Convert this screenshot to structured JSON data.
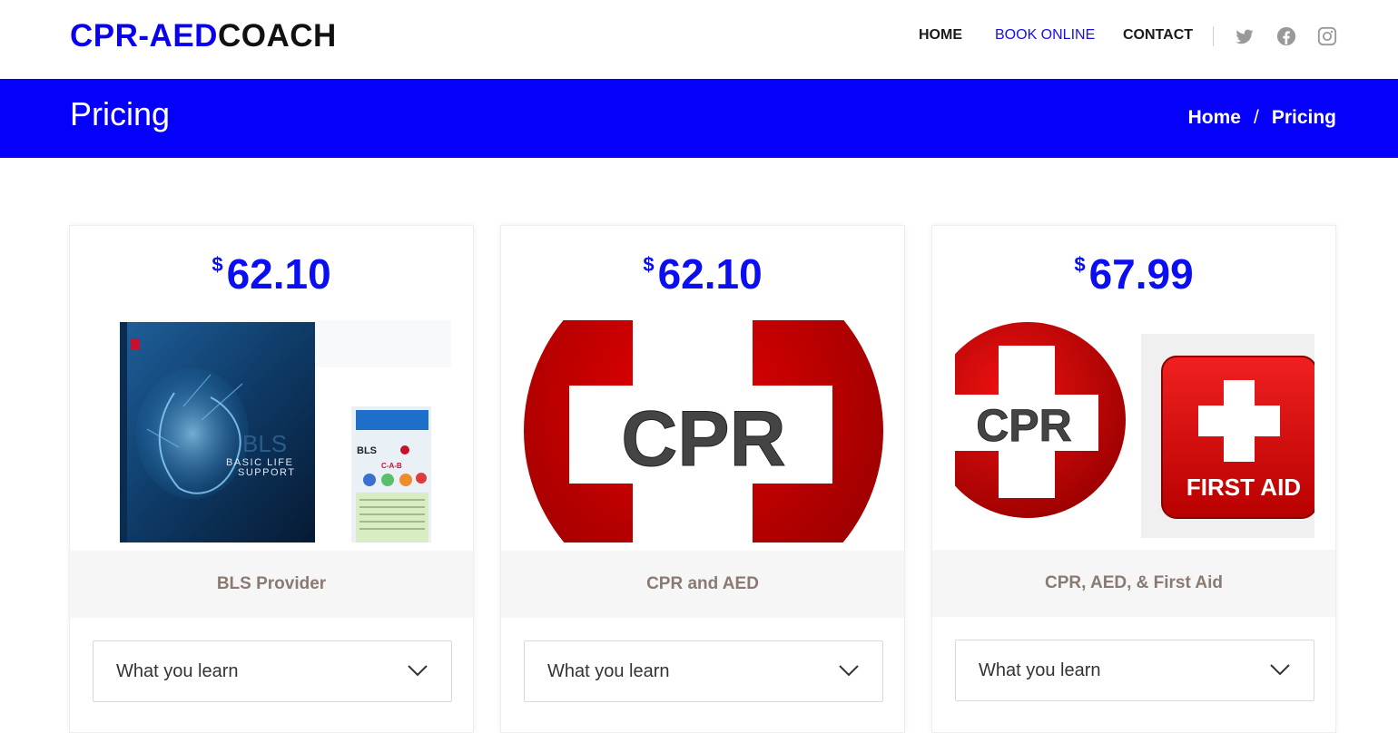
{
  "brand": {
    "part1": "CPR-AED",
    "part2": "COACH"
  },
  "nav": {
    "home": "HOME",
    "book_online": "BOOK ONLINE",
    "contact": "CONTACT",
    "social_icons": [
      "twitter-icon",
      "facebook-icon",
      "instagram-icon"
    ]
  },
  "banner": {
    "title": "Pricing",
    "breadcrumb": {
      "home": "Home",
      "separator": "/",
      "current": "Pricing"
    }
  },
  "cards": [
    {
      "currency": "$",
      "price": "62.10",
      "name": "BLS Provider",
      "accordion_label": "What you learn",
      "image_text": {
        "cover_line1": "BLS",
        "cover_line2": "BASIC LIFE",
        "cover_line3": "SUPPORT",
        "card_title": "BLS",
        "card_sub": "C-A-B"
      }
    },
    {
      "currency": "$",
      "price": "62.10",
      "name": "CPR and AED",
      "accordion_label": "What you learn",
      "image_text": {
        "badge": "CPR"
      }
    },
    {
      "currency": "$",
      "price": "67.99",
      "name": "CPR, AED, & First Aid",
      "accordion_label": "What you learn",
      "image_text": {
        "badge": "CPR",
        "first_aid": "FIRST AID"
      }
    }
  ],
  "colors": {
    "brand_blue": "#0a00f0",
    "banner_blue": "#0500f9",
    "price_blue": "#0a0ef0",
    "plan_text": "#8a7a72",
    "red": "#d00000"
  }
}
